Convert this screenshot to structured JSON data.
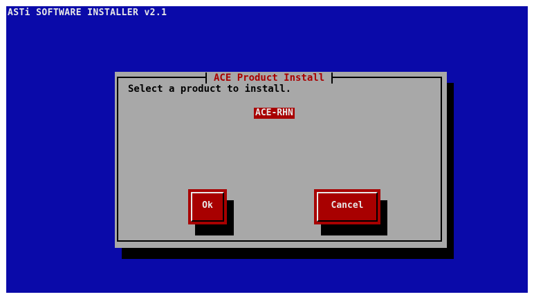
{
  "screen": {
    "title": "ASTi SOFTWARE INSTALLER v2.1",
    "background_color": "#0a0aa9"
  },
  "dialog": {
    "title": "ACE Product Install",
    "prompt": "Select a product to install.",
    "products": [
      {
        "label": "ACE-RHN",
        "selected": true
      }
    ],
    "ok_label": "Ok",
    "cancel_label": "Cancel",
    "accent_color": "#a80000",
    "panel_color": "#a8a8a8"
  }
}
